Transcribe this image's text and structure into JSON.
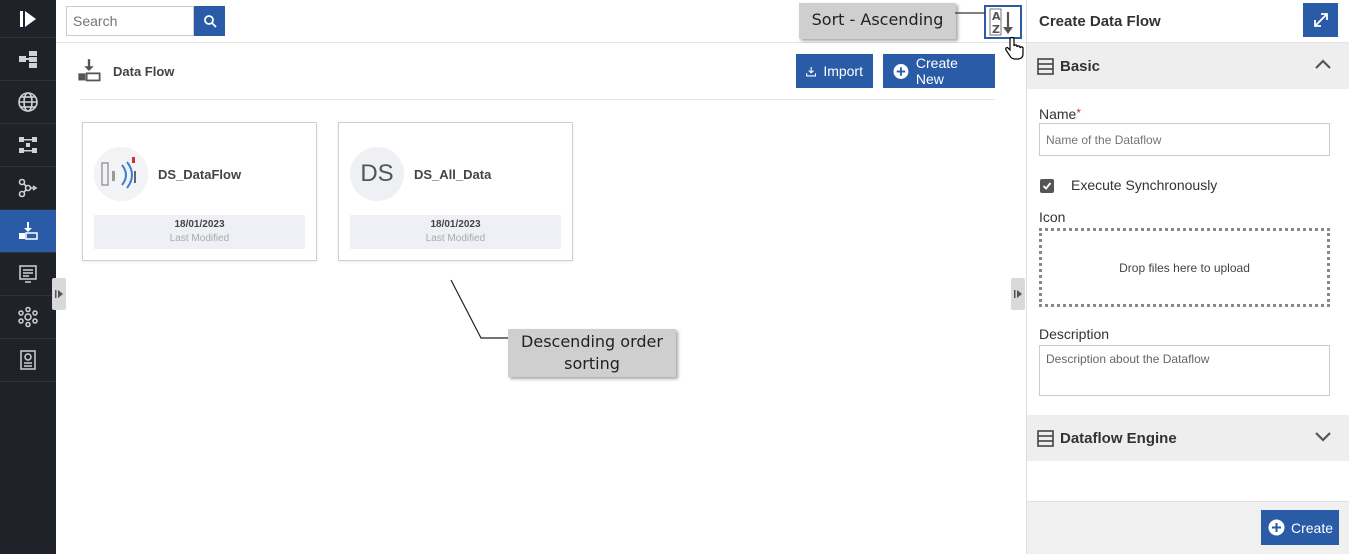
{
  "search": {
    "placeholder": "Search"
  },
  "tooltips": {
    "sort": "Sort - Ascending",
    "annotation": "Descending order sorting"
  },
  "page": {
    "title": "Data Flow",
    "import_label": "Import",
    "create_new_label": "Create New"
  },
  "cards": [
    {
      "name": "DS_DataFlow",
      "initials": "",
      "date": "18/01/2023",
      "meta_label": "Last Modified"
    },
    {
      "name": "DS_All_Data",
      "initials": "DS",
      "date": "18/01/2023",
      "meta_label": "Last Modified"
    }
  ],
  "panel": {
    "title": "Create Data Flow",
    "sections": {
      "basic": "Basic",
      "engine": "Dataflow Engine"
    },
    "name_label": "Name",
    "required_mark": "*",
    "name_placeholder": "Name of the Dataflow",
    "execute_sync_label": "Execute Synchronously",
    "execute_sync_checked": true,
    "icon_label": "Icon",
    "dropzone_text": "Drop files here to upload",
    "description_label": "Description",
    "description_placeholder": "Description about the Dataflow",
    "create_label": "Create"
  },
  "colors": {
    "primary": "#2a5ba7",
    "nav_bg": "#1f2329",
    "callout_bg": "#cfcfcf"
  },
  "nav_icons": [
    "logo-icon",
    "hierarchy-icon",
    "globe-icon",
    "workflow-icon",
    "pipeline-icon",
    "data-flow-icon",
    "report-icon",
    "network-icon",
    "document-settings-icon"
  ]
}
